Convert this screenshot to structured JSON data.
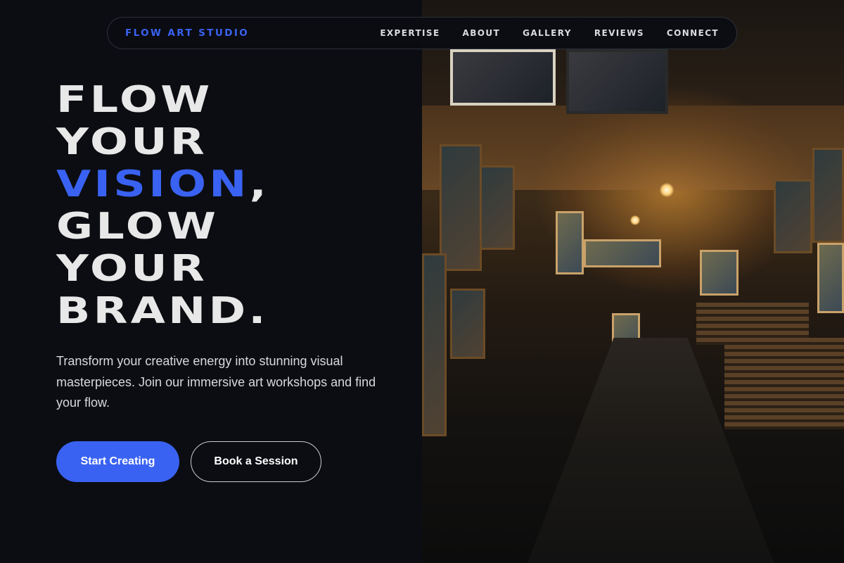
{
  "nav": {
    "brand": "FLOW ART STUDIO",
    "links": [
      "EXPERTISE",
      "ABOUT",
      "GALLERY",
      "REVIEWS",
      "CONNECT"
    ]
  },
  "hero": {
    "title_lines": [
      "FLOW",
      "YOUR",
      "VISION",
      ",",
      "GLOW",
      "YOUR",
      "BRAND."
    ],
    "subtitle": "Transform your creative energy into stunning visual masterpieces. Join our immersive art workshops and find your flow.",
    "primary_cta": "Start Creating",
    "secondary_cta": "Book a Session"
  },
  "colors": {
    "accent": "#3a62f2",
    "background": "#0b0d12",
    "text": "#e8e8e8"
  }
}
